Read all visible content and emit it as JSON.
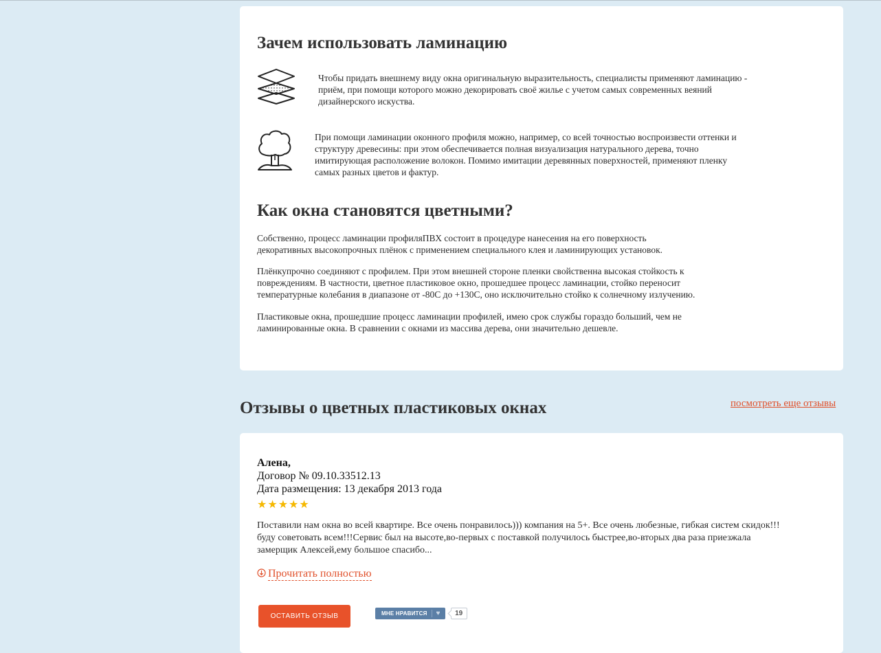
{
  "lamination": {
    "heading": "Зачем использовать ламинацию",
    "items": [
      {
        "icon": "layers-icon",
        "text": "Чтобы придать внешнему виду окна оригинальную выразительность, специалисты применяют ламинацию - приём, при помощи которого можно декорировать своё жилье с учетом самых современных веяний дизайнерского искуства."
      },
      {
        "icon": "tree-icon",
        "text": "При помощи ламинации оконного профиля можно, например, со всей точностью воспроизвести оттенки и структуру древесины: при этом обеспечивается полная визуализация натурального дерева, точно имитирующая расположение волокон. Помимо имитации деревянных поверхностей, применяют пленку самых разных цветов и фактур."
      }
    ]
  },
  "colored": {
    "heading": "Как окна становятся цветными?",
    "paragraphs": [
      "Собственно, процесс ламинации профиляПВХ состоит в процедуре нанесения на его поверхность декоративных высокопрочных плёнок с применением специального клея и ламинирующих установок.",
      "Плёнкупрочно соединяют с профилем. При этом внешней стороне пленки свойственна высокая стойкость к повреждениям. В частности, цветное пластиковое окно, прошедшее процесс ламинации, стойко переносит температурные колебания в диапазоне от -80С до +130С, оно исключительно стойко к солнечному излучению.",
      "Пластиковые окна, прошедшие процесс ламинации профилей, имею срок службы гораздо больший, чем не ламинированные окна. В сравнении с окнами из массива дерева, они значительно дешевле."
    ]
  },
  "reviews": {
    "heading": "Отзывы о цветных пластиковых окнах",
    "more_link": "посмотреть еще отзывы",
    "review": {
      "author": "Алена,",
      "contract": "Договор № 09.10.33512.13",
      "date": "Дата размещения: 13 декабря 2013 года",
      "rating": 5,
      "text": "Поставили нам окна во всей квартире. Все очень понравилось))) компания на 5+. Все очень любезные, гибкая систем скидок!!! буду советовать всем!!!Сервис был на высоте,во-первых с поставкой получилось быстрее,во-вторых два раза приезжала замерщик Алексей,ему большое спасибо...",
      "read_more": "Прочитать полностью"
    },
    "leave_review_button": "оставить отзыв",
    "like": {
      "label": "Мне нравится",
      "count": "19"
    }
  },
  "colors": {
    "page_background": "#dcebf4",
    "accent": "#e8522a",
    "star": "#f5b800",
    "like_button": "#5b7fa6"
  }
}
